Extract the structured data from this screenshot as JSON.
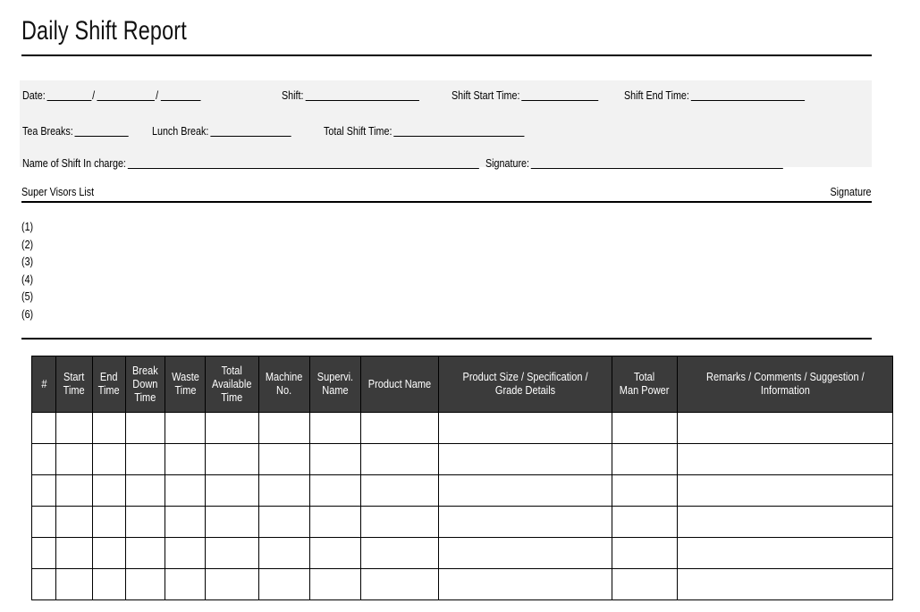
{
  "document": {
    "title": "Daily Shift Report"
  },
  "form": {
    "date": {
      "label": "Date:",
      "separator1": "/",
      "separator2": "/"
    },
    "shift": {
      "label": "Shift:"
    },
    "shift_start_time": {
      "label": "Shift Start Time:"
    },
    "shift_end_time": {
      "label": "Shift End Time:"
    },
    "tea_breaks": {
      "label": "Tea Breaks:"
    },
    "lunch_break": {
      "label": "Lunch Break:"
    },
    "total_shift_time": {
      "label": "Total Shift Time:"
    },
    "name_of_shift_in_charge": {
      "label": "Name of Shift In charge:"
    },
    "signature": {
      "label": "Signature:"
    }
  },
  "supervisors": {
    "heading": "Super Visors List",
    "signature_heading": "Signature",
    "items": [
      "(1)",
      "(2)",
      "(3)",
      "(4)",
      "(5)",
      "(6)"
    ]
  },
  "table": {
    "columns": [
      "#",
      "Start\nTime",
      "End\nTime",
      "Break\nDown\nTime",
      "Waste\nTime",
      "Total\nAvailable\nTime",
      "Machine\nNo.",
      "Supervi.\nName",
      "Product Name",
      "Product Size / Specification /\nGrade Details",
      "Total\nMan Power",
      "Remarks / Comments / Suggestion /\nInformation"
    ],
    "row_count": 6
  },
  "colors": {
    "header_fill": "#3b3b3b",
    "header_text": "#ffffff",
    "panel_fill": "#f2f2f2",
    "rule": "#000000",
    "page_background": "#ffffff"
  }
}
